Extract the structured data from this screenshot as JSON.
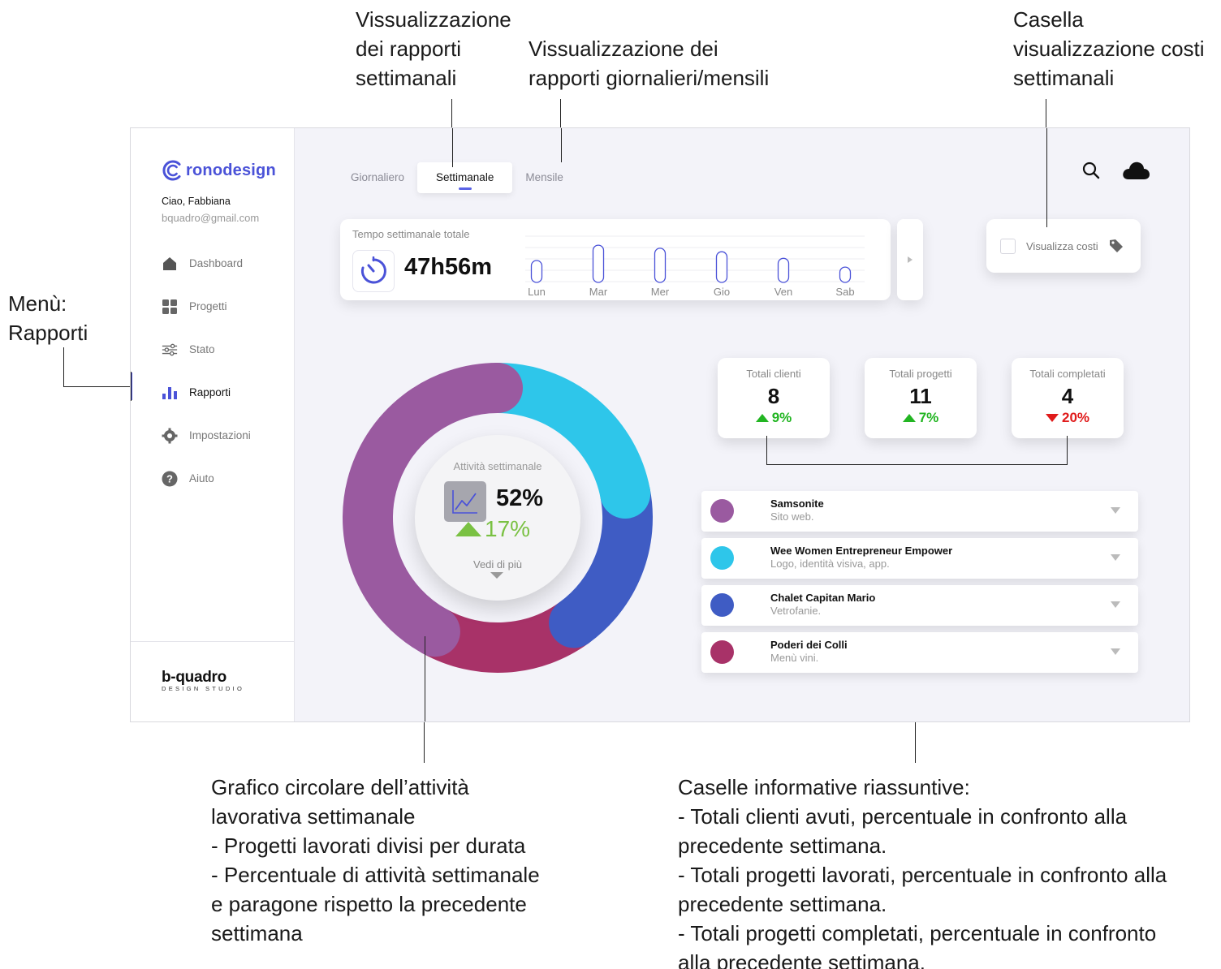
{
  "annotations": {
    "weekly_reports": "Vissualizzazione\ndei rapporti\nsettimanali",
    "daily_monthly_reports": "Vissualizzazione dei\nrapporti giornalieri/mensili",
    "costs_box": "Casella\nvisualizzazione costi\nsettimanali",
    "menu_reports": "Menù:\nRapporti",
    "donut_chart": "Grafico circolare dell’attività\nlavorativa settimanale\n- Progetti lavorati divisi per durata\n- Percentuale di attività settimanale\ne paragone rispetto la precedente\nsettimana",
    "summary_boxes": "Caselle informative riassuntive:\n- Totali clienti avuti, percentuale in confronto alla\nprecedente settimana.\n- Totali progetti lavorati, percentuale in confronto alla\nprecedente settimana.\n- Totali progetti completati, percentuale in confronto\nalla precedente settimana."
  },
  "app": {
    "logo_text": "ronodesign",
    "greeting": "Ciao, Fabbiana",
    "email": "bquadro@gmail.com",
    "menu": [
      {
        "label": "Dashboard",
        "icon": "home-icon"
      },
      {
        "label": "Progetti",
        "icon": "grid-icon"
      },
      {
        "label": "Stato",
        "icon": "sliders-icon"
      },
      {
        "label": "Rapporti",
        "icon": "bar-chart-icon",
        "active": true
      },
      {
        "label": "Impostazioni",
        "icon": "gear-icon"
      },
      {
        "label": "Aiuto",
        "icon": "help-icon"
      }
    ],
    "studio_name": "b-quadro",
    "studio_sub": "DESIGN STUDIO"
  },
  "tabs": [
    {
      "label": "Giornaliero"
    },
    {
      "label": "Settimanale",
      "active": true
    },
    {
      "label": "Mensile"
    }
  ],
  "time_card": {
    "label": "Tempo settimanale totale",
    "value": "47h56m",
    "days": [
      "Lun",
      "Mar",
      "Mer",
      "Gio",
      "Ven",
      "Sab"
    ],
    "day_levels": [
      0.5,
      0.85,
      0.78,
      0.7,
      0.55,
      0.35
    ]
  },
  "costs": {
    "label": "Visualizza costi",
    "checked": false
  },
  "activity": {
    "label": "Attività settimanale",
    "value": "52%",
    "trend": "17%",
    "trend_direction": "up",
    "more_label": "Vedi di più"
  },
  "chart_data": {
    "type": "pie",
    "variant": "donut",
    "categories": [
      "Samsonite",
      "Wee Women Entrepreneur Empower",
      "Chalet Capitan Mario",
      "Poderi dei Colli"
    ],
    "values": [
      42,
      22,
      18,
      18
    ],
    "colors": [
      "#9a5aa0",
      "#2ec6ea",
      "#3f5cc4",
      "#a83268"
    ]
  },
  "stats": [
    {
      "label": "Totali clienti",
      "value": "8",
      "delta": "9%",
      "direction": "up"
    },
    {
      "label": "Totali progetti",
      "value": "11",
      "delta": "7%",
      "direction": "up"
    },
    {
      "label": "Totali completati",
      "value": "4",
      "delta": "20%",
      "direction": "down"
    }
  ],
  "projects": [
    {
      "name": "Samsonite",
      "desc": "Sito web.",
      "color": "#9a5aa0"
    },
    {
      "name": "Wee Women Entrepreneur Empower",
      "desc": "Logo, identità visiva, app.",
      "color": "#2ec6ea"
    },
    {
      "name": "Chalet Capitan Mario",
      "desc": "Vetrofanie.",
      "color": "#3f5cc4"
    },
    {
      "name": "Poderi dei Colli",
      "desc": "Menù vini.",
      "color": "#a83268"
    }
  ]
}
